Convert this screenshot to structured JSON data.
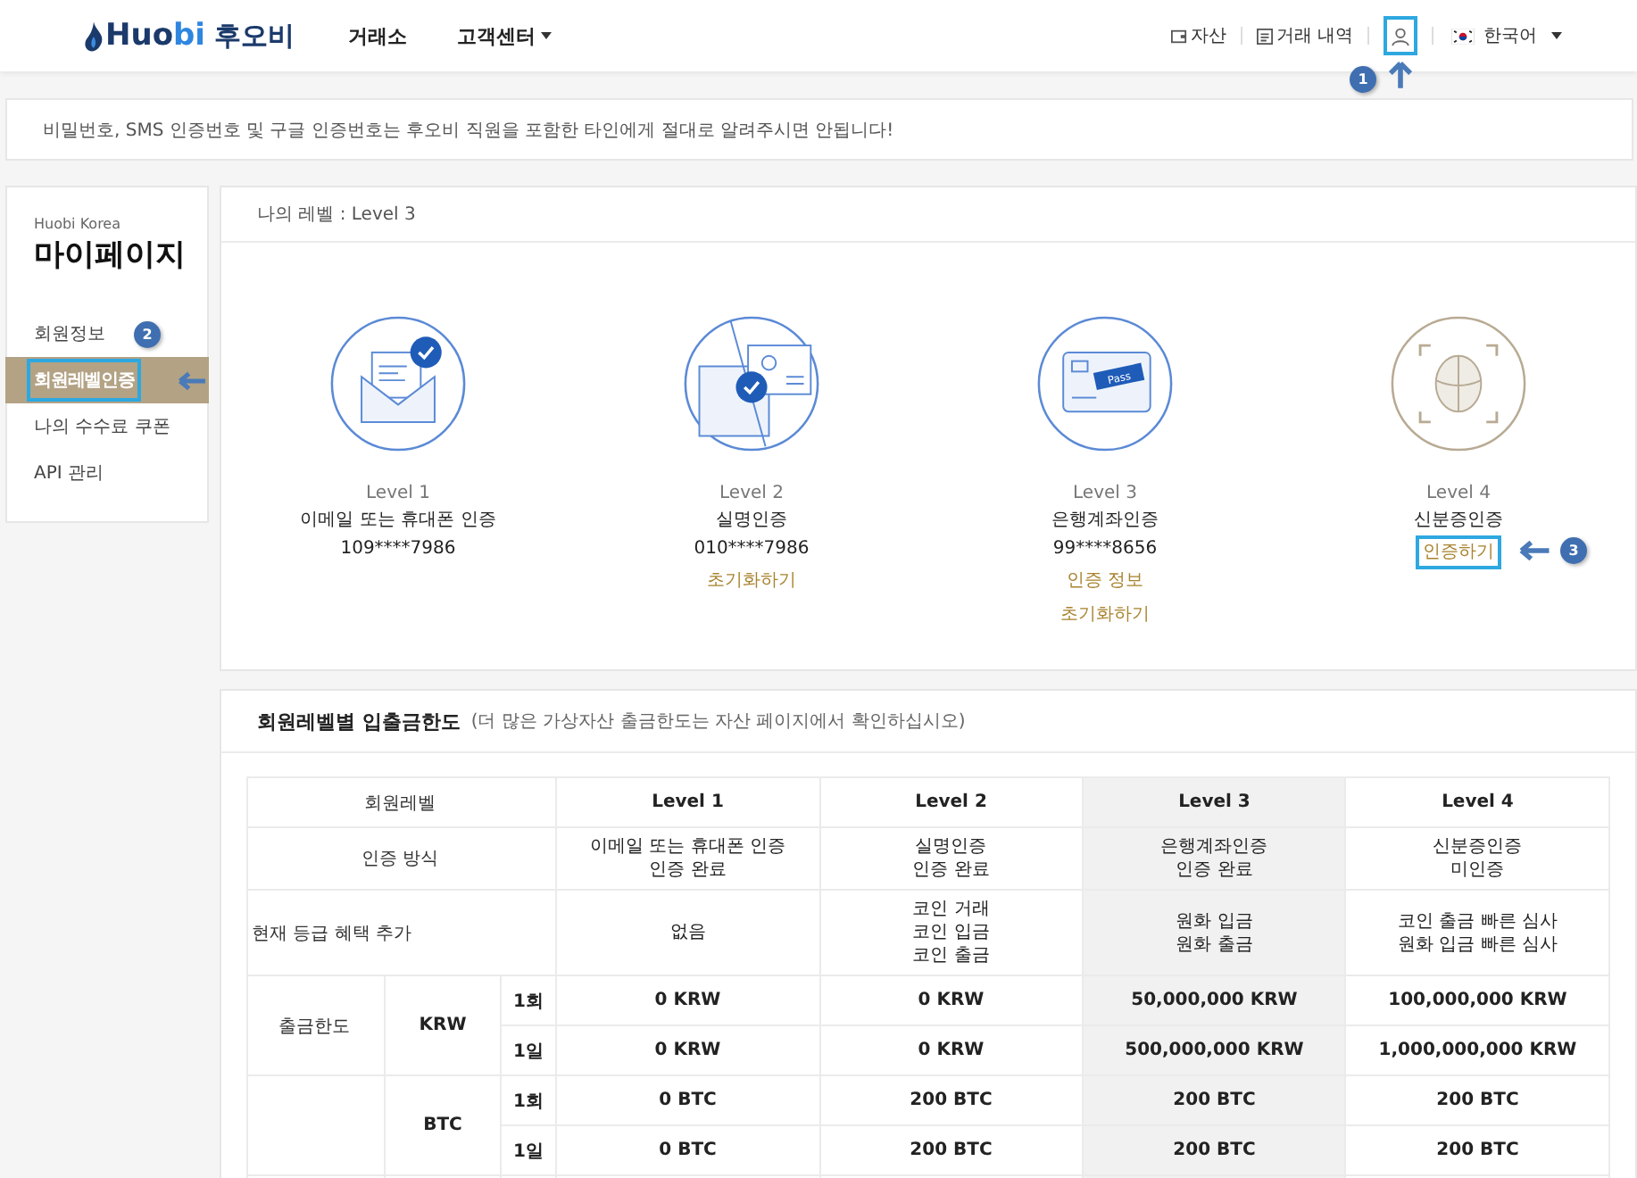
{
  "header": {
    "logo": {
      "main": "Huo",
      "accent": "bi",
      "korean": "후오비"
    },
    "nav": [
      {
        "label": "거래소",
        "dropdown": false
      },
      {
        "label": "고객센터",
        "dropdown": true
      }
    ],
    "links": [
      {
        "label": "자산",
        "kind": "wallet"
      },
      {
        "label": "거래 내역",
        "kind": "document"
      }
    ],
    "profile": {
      "outlined": true,
      "badge": "1"
    },
    "language": {
      "label": "한국어",
      "dropdown": true
    }
  },
  "notice": "비밀번호, SMS 인증번호 및 구글 인증번호는 후오비 직원을 포함한 타인에게 절대로 알려주시면 안됩니다!",
  "sidebar": {
    "brand": "Huobi Korea",
    "title": "마이페이지",
    "badge": "2",
    "items": [
      {
        "label": "회원정보",
        "selected": false
      },
      {
        "label": "회원레벨인증",
        "selected": true
      },
      {
        "label": "나의 수수료 쿠폰",
        "selected": false
      },
      {
        "label": "API 관리",
        "selected": false
      }
    ]
  },
  "my_level": "나의 레벨 : Level 3",
  "levels": [
    {
      "kind": "envelope",
      "verified": true,
      "level": "Level 1",
      "name": "이메일 또는 휴대폰 인증",
      "detail": "109****7986"
    },
    {
      "kind": "id",
      "verified": true,
      "level": "Level 2",
      "name": "실명인증",
      "detail": "010****7986",
      "actions": [
        {
          "label": "초기화하기",
          "outlined": false
        }
      ]
    },
    {
      "kind": "card",
      "icon_label": "Pass",
      "verified": true,
      "level": "Level 3",
      "name": "은행계좌인증",
      "detail": "99****8656",
      "actions": [
        {
          "label": "인증 정보",
          "outlined": false
        },
        {
          "label": "초기화하기",
          "outlined": false
        }
      ]
    },
    {
      "kind": "face",
      "verified": false,
      "level": "Level 4",
      "name": "신분증인증",
      "actions": [
        {
          "label": "인증하기",
          "outlined": true
        }
      ],
      "badge": "3"
    }
  ],
  "limits": {
    "title": "회원레벨별 입출금한도",
    "note": "(더 많은 가상자산 출금한도는 자산 페이지에서 확인하십시오)",
    "columns": [
      {
        "label": "회원레벨"
      },
      {
        "label": "Level 1",
        "selected": false
      },
      {
        "label": "Level 2",
        "selected": false
      },
      {
        "label": "Level 3",
        "selected": true
      },
      {
        "label": "Level 4",
        "selected": false
      }
    ],
    "info_rows": [
      {
        "label": "인증 방식",
        "values": [
          "이메일 또는 휴대폰 인증\n인증 완료",
          "실명인증\n인증 완료",
          "은행계좌인증\n인증 완료",
          "신분증인증\n미인증"
        ]
      },
      {
        "label": "현재 등급 혜택 추가",
        "values": [
          "없음",
          "코인 거래\n코인 입금\n코인 출금",
          "원화 입금\n원화 출금",
          "코인 출금 빠른 심사\n원화 입금 빠른 심사"
        ]
      }
    ],
    "groups": [
      {
        "label": "출금한도",
        "currency": "KRW",
        "rows": [
          {
            "period": "1회",
            "values": [
              "0 KRW",
              "0 KRW",
              "50,000,000 KRW",
              "100,000,000 KRW"
            ]
          },
          {
            "period": "1일",
            "values": [
              "0 KRW",
              "0 KRW",
              "500,000,000 KRW",
              "1,000,000,000 KRW"
            ]
          }
        ]
      },
      {
        "currency": "BTC",
        "rows": [
          {
            "period": "1회",
            "values": [
              "0 BTC",
              "200 BTC",
              "200 BTC",
              "200 BTC"
            ]
          },
          {
            "period": "1일",
            "values": [
              "0 BTC",
              "200 BTC",
              "200 BTC",
              "200 BTC"
            ]
          }
        ]
      }
    ]
  }
}
